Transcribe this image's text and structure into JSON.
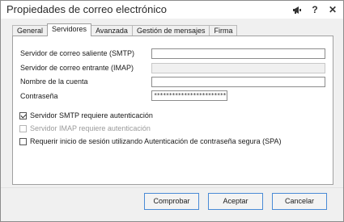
{
  "window": {
    "title": "Propiedades de correo electrónico"
  },
  "titlebar_icons": [
    "megaphone-icon",
    "help-icon",
    "close-icon"
  ],
  "titlebar_glyphs": {
    "help": "?",
    "close": "✕"
  },
  "tabs": [
    {
      "label": "General",
      "active": false
    },
    {
      "label": "Servidores",
      "active": true
    },
    {
      "label": "Avanzada",
      "active": false
    },
    {
      "label": "Gestión de mensajes",
      "active": false
    },
    {
      "label": "Firma",
      "active": false
    }
  ],
  "fields": {
    "smtp_label": "Servidor de correo saliente (SMTP)",
    "smtp_value": "",
    "imap_label": "Servidor de correo entrante (IMAP)",
    "imap_value": "",
    "account_label": "Nombre de la cuenta",
    "account_value": "",
    "password_label": "Contraseña",
    "password_value": "************************************"
  },
  "checks": {
    "smtp_auth": {
      "label": "Servidor SMTP requiere autenticación",
      "checked": true,
      "enabled": true
    },
    "imap_auth": {
      "label": "Servidor IMAP requiere autenticación",
      "checked": false,
      "enabled": false
    },
    "spa": {
      "label": "Requerir inicio de sesión utilizando Autenticación de contraseña segura (SPA)",
      "checked": false,
      "enabled": true
    }
  },
  "buttons": {
    "test": "Comprobar",
    "ok": "Aceptar",
    "cancel": "Cancelar"
  },
  "colors": {
    "button_border": "#4a8bd6",
    "disabled_text": "#9a9a9a"
  }
}
